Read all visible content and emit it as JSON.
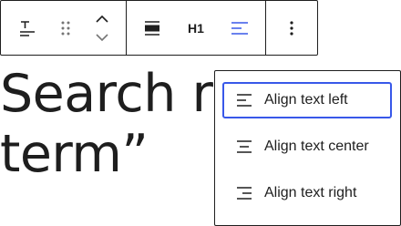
{
  "content": {
    "heading_text": "Search re\nterm”"
  },
  "toolbar": {
    "block_type_icon": "paragraph-heading-icon",
    "drag_icon": "drag-handle-icon",
    "move_icon": "move-up-down-icon",
    "wide_icon": "align-wide-icon",
    "heading_level_label": "H1",
    "align_icon": "align-left-icon",
    "more_icon": "more-vertical-icon"
  },
  "align_menu": {
    "items": [
      {
        "label": "Align text left",
        "icon": "align-left-icon",
        "focused": true
      },
      {
        "label": "Align text center",
        "icon": "align-center-icon",
        "focused": false
      },
      {
        "label": "Align text right",
        "icon": "align-right-icon",
        "focused": false
      }
    ]
  },
  "colors": {
    "accent": "#3858e9",
    "text": "#1e1e1e",
    "icon_muted": "#757575"
  }
}
